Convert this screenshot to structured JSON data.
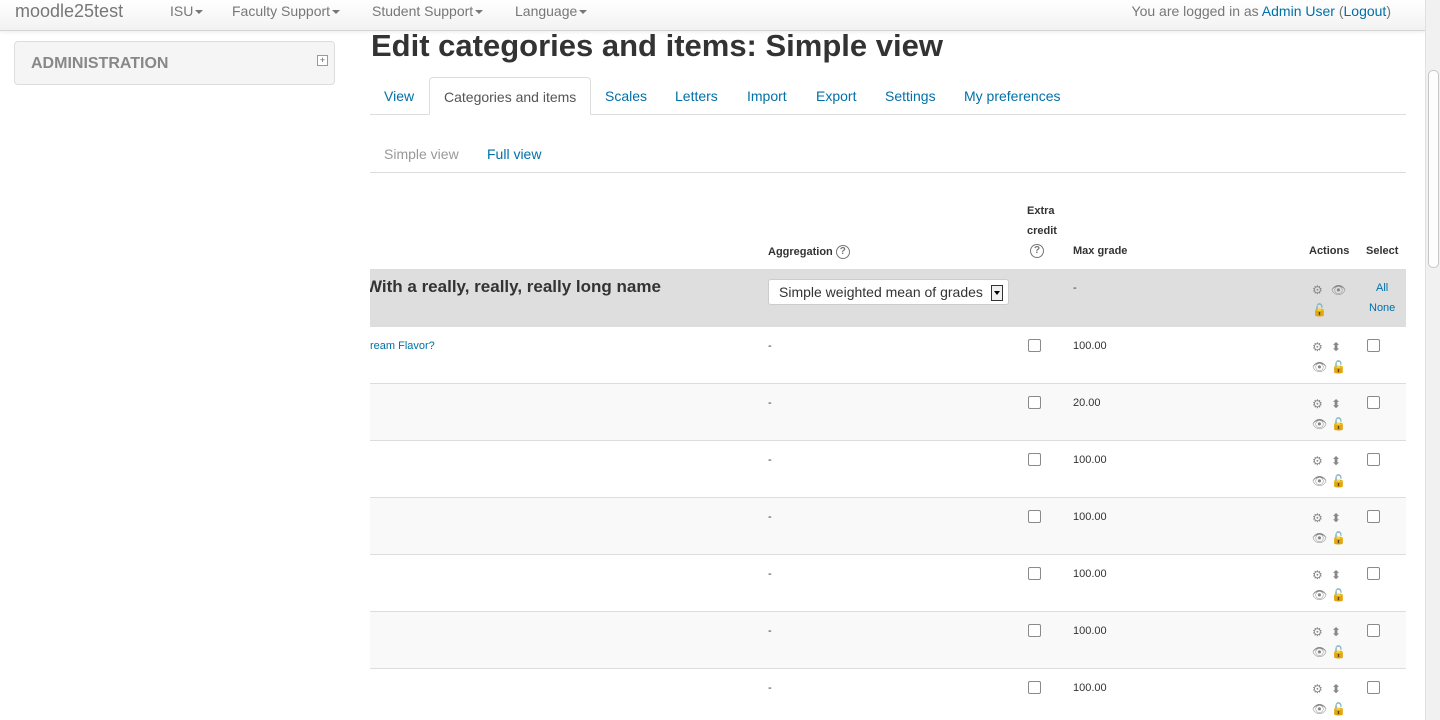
{
  "navbar": {
    "brand": "moodle25test",
    "menus": [
      "ISU",
      "Faculty Support",
      "Student Support",
      "Language"
    ],
    "login_prefix": "You are logged in as ",
    "user_name": "Admin User",
    "logout_label": "Logout"
  },
  "admin_block": {
    "title": "ADMINISTRATION"
  },
  "page": {
    "title": "Edit categories and items: Simple view"
  },
  "tabs": [
    "View",
    "Categories and items",
    "Scales",
    "Letters",
    "Import",
    "Export",
    "Settings",
    "My preferences"
  ],
  "active_tab": "Categories and items",
  "subtabs": [
    "Simple view",
    "Full view"
  ],
  "table": {
    "headers": {
      "aggregation": "Aggregation",
      "extra_credit_1": "Extra",
      "extra_credit_2": "credit",
      "max_grade": "Max grade",
      "actions": "Actions",
      "select": "Select"
    },
    "category": {
      "name": "With a really, really, really long name",
      "aggregation": "Simple weighted mean of grades",
      "max_grade": "-",
      "select_all": "All",
      "select_none": "None"
    },
    "rows": [
      {
        "name": "ream Flavor?",
        "aggregation": "-",
        "max_grade": "100.00"
      },
      {
        "name": "",
        "aggregation": "-",
        "max_grade": "20.00"
      },
      {
        "name": "",
        "aggregation": "-",
        "max_grade": "100.00"
      },
      {
        "name": "",
        "aggregation": "-",
        "max_grade": "100.00"
      },
      {
        "name": "",
        "aggregation": "-",
        "max_grade": "100.00"
      },
      {
        "name": "",
        "aggregation": "-",
        "max_grade": "100.00"
      },
      {
        "name": "",
        "aggregation": "-",
        "max_grade": "100.00"
      }
    ]
  },
  "icons": {
    "edit": "gear-icon",
    "move": "move-icon",
    "hide": "eye-icon",
    "lock": "lock-icon",
    "help": "help-icon"
  },
  "colors": {
    "link": "#0070a8",
    "category_row": "#dedede"
  }
}
